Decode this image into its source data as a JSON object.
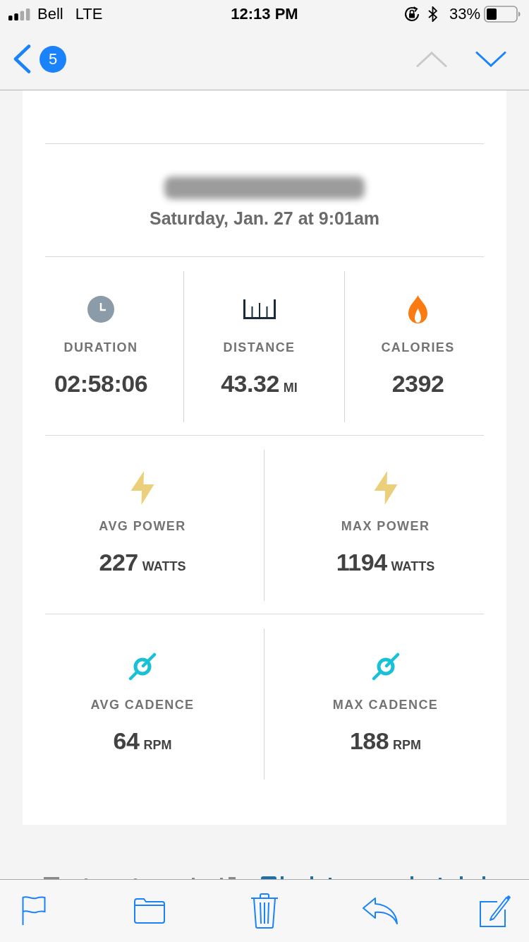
{
  "status_bar": {
    "carrier": "Bell",
    "network": "LTE",
    "time": "12:13 PM",
    "battery": "33%"
  },
  "nav_bar": {
    "unread_count": "5",
    "previous": {
      "disabled": true
    },
    "next": {
      "disabled": false
    }
  },
  "workout": {
    "date": "Saturday, Jan. 27 at 9:01am",
    "stat_rows": [
      {
        "stats": [
          {
            "kind": "clock",
            "label": "DURATION",
            "value": "02:58:06"
          },
          {
            "kind": "distance",
            "label": "DISTANCE",
            "value": "43.32",
            "unit": "MI"
          },
          {
            "kind": "flame",
            "label": "CALORIES",
            "value": "2392"
          }
        ]
      },
      {
        "stats": [
          {
            "kind": "power",
            "label": "AVG POWER",
            "value": "227",
            "unit": "WATTS"
          },
          {
            "kind": "power",
            "label": "MAX POWER",
            "value": "1194",
            "unit": "WATTS"
          }
        ]
      },
      {
        "stats": [
          {
            "kind": "cadence",
            "label": "AVG CADENCE",
            "value": "64",
            "unit": "RPM"
          },
          {
            "kind": "cadence",
            "label": "MAX CADENCE",
            "value": "188",
            "unit": "RPM"
          }
        ]
      }
    ]
  }
}
